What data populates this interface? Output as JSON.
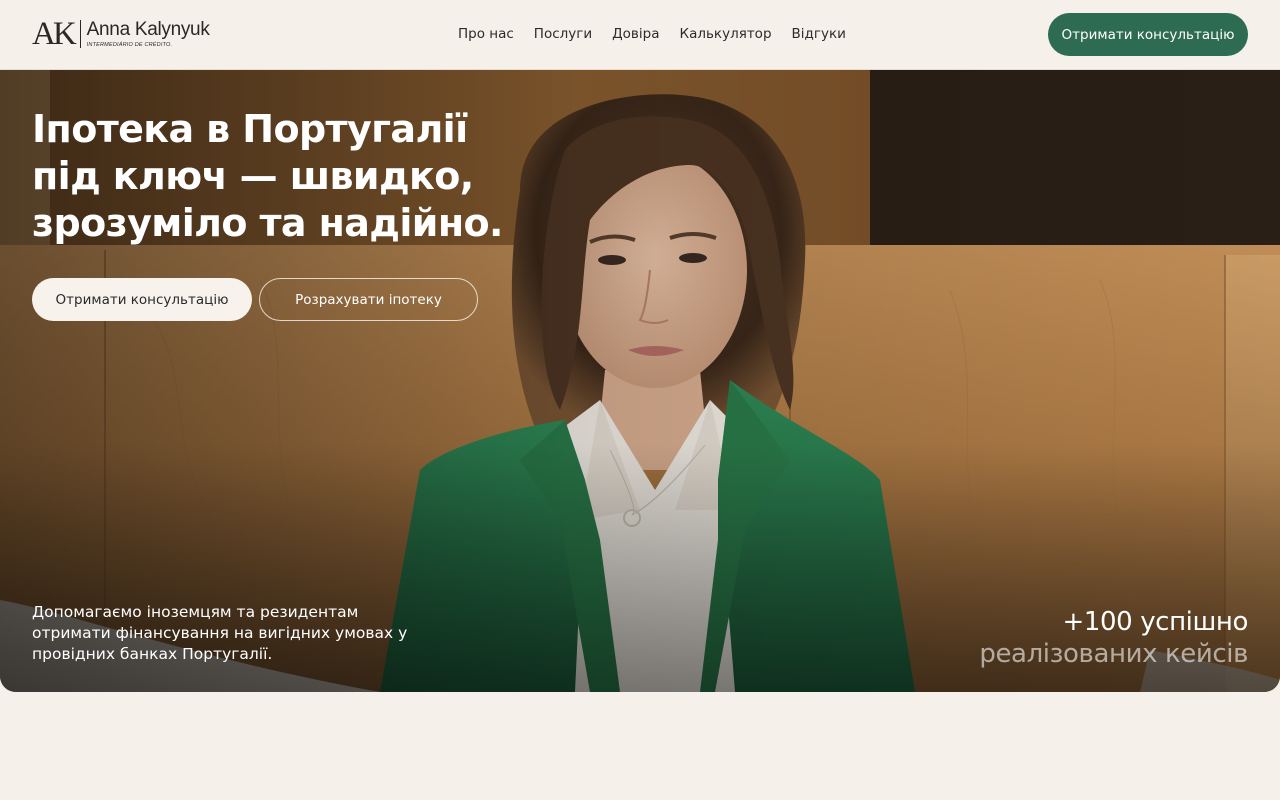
{
  "brand": {
    "monogram": "AK",
    "name": "Anna Kalynyuk",
    "subtitle": "INTERMEDIÁRIO DE CRÉDITO."
  },
  "nav": {
    "items": [
      "Про нас",
      "Послуги",
      "Довіра",
      "Калькулятор",
      "Відгуки"
    ]
  },
  "header": {
    "cta_label": "Отримати консультацію"
  },
  "hero": {
    "title": "Іпотека в Португалії під ключ — швидко, зрозуміло та надійно.",
    "primary_button": "Отримати консультацію",
    "secondary_button": "Розрахувати іпотеку",
    "description": "Допомагаємо іноземцям та резидентам отримати фінансування на вигідних умовах у провідних банках Португалії.",
    "stat_number": "+100 успішно",
    "stat_label": "реалізованих кейсів"
  },
  "colors": {
    "accent": "#2e6b53",
    "page_bg": "#f5f0e9",
    "jacket": "#2f7d52"
  },
  "icons": [
    "brand-logo",
    "portrait-photo"
  ]
}
